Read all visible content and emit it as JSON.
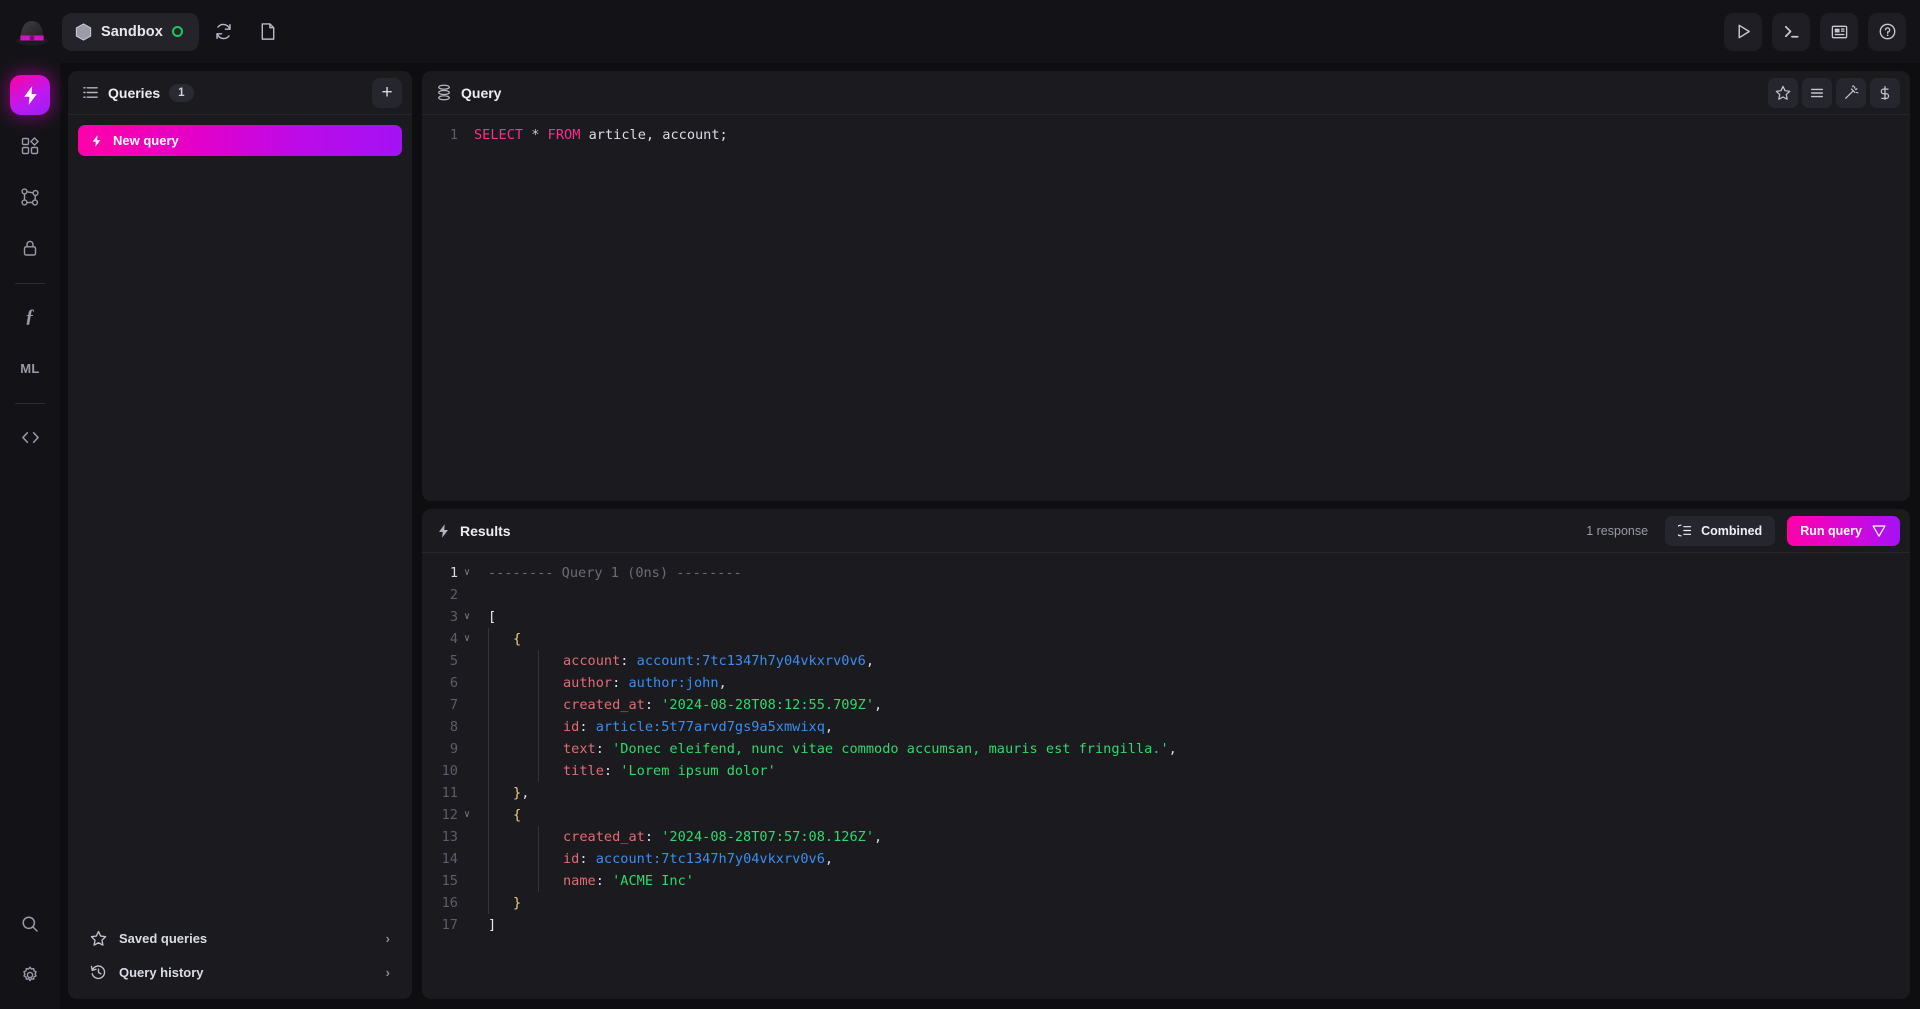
{
  "topbar": {
    "logo": "bowler-hat-logo",
    "namespace": "Sandbox",
    "status": "connected",
    "reconnect_icon": "refresh-icon",
    "file_icon": "file-icon",
    "actions": [
      {
        "icon": "play-icon",
        "name": "run"
      },
      {
        "icon": "terminal-icon",
        "name": "console"
      },
      {
        "icon": "docs-icon",
        "name": "documentation"
      },
      {
        "icon": "help-icon",
        "name": "help"
      }
    ]
  },
  "rail": {
    "items": [
      {
        "icon": "lightning-icon",
        "label": "",
        "active": true
      },
      {
        "icon": "grid-icon",
        "label": "",
        "active": false
      },
      {
        "icon": "graph-icon",
        "label": "",
        "active": false
      },
      {
        "icon": "lock-icon",
        "label": "",
        "active": false
      },
      {
        "icon": "function-icon",
        "label": "ƒ",
        "active": false
      },
      {
        "icon": "ml-icon",
        "label": "ML",
        "active": false
      },
      {
        "icon": "code-icon",
        "label": "",
        "active": false
      }
    ],
    "bottom": [
      {
        "icon": "search-icon",
        "name": "search"
      },
      {
        "icon": "gear-icon",
        "name": "settings"
      }
    ]
  },
  "queries": {
    "title": "Queries",
    "count": "1",
    "add_label": "+",
    "items": [
      {
        "label": "New query",
        "icon": "lightning-icon",
        "selected": true
      }
    ],
    "footer": [
      {
        "label": "Saved queries",
        "icon": "star-icon",
        "chevron": "›"
      },
      {
        "label": "Query history",
        "icon": "history-icon",
        "chevron": "›"
      }
    ]
  },
  "query_panel": {
    "title": "Query",
    "icon": "database-icon",
    "actions": [
      {
        "icon": "star-icon",
        "name": "save-query"
      },
      {
        "icon": "format-icon",
        "name": "format-query"
      },
      {
        "icon": "magic-wand-icon",
        "name": "beautify-query"
      },
      {
        "icon": "dollar-icon",
        "name": "variables"
      }
    ],
    "lines": [
      {
        "num": "1",
        "tokens": [
          {
            "t": "SELECT",
            "c": "kw"
          },
          {
            "t": " ",
            "c": "pl"
          },
          {
            "t": "*",
            "c": "op"
          },
          {
            "t": " ",
            "c": "pl"
          },
          {
            "t": "FROM",
            "c": "kw"
          },
          {
            "t": " article, account;",
            "c": "pl"
          }
        ]
      }
    ]
  },
  "results_panel": {
    "title": "Results",
    "icon": "lightning-icon",
    "response_count": "1 response",
    "combined_label": "Combined",
    "combined_icon": "list-icon",
    "run_label": "Run query",
    "run_icon": "send-icon",
    "lines": [
      {
        "num": "1",
        "fold": "v",
        "indent": 0,
        "current": true,
        "tokens": [
          {
            "t": "-------- Query 1 (0ns) --------",
            "c": "cmt"
          }
        ]
      },
      {
        "num": "2",
        "fold": "",
        "indent": 0,
        "tokens": []
      },
      {
        "num": "3",
        "fold": "v",
        "indent": 0,
        "tokens": [
          {
            "t": "[",
            "c": "brw"
          }
        ]
      },
      {
        "num": "4",
        "fold": "v",
        "indent": 1,
        "tokens": [
          {
            "t": "{",
            "c": "br"
          }
        ]
      },
      {
        "num": "5",
        "fold": "",
        "indent": 2,
        "tokens": [
          {
            "t": "account",
            "c": "key"
          },
          {
            "t": ": ",
            "c": "pl"
          },
          {
            "t": "account:7tc1347h7y04vkxrv0v6",
            "c": "rec"
          },
          {
            "t": ",",
            "c": "pl"
          }
        ]
      },
      {
        "num": "6",
        "fold": "",
        "indent": 2,
        "tokens": [
          {
            "t": "author",
            "c": "key"
          },
          {
            "t": ": ",
            "c": "pl"
          },
          {
            "t": "author:john",
            "c": "rec"
          },
          {
            "t": ",",
            "c": "pl"
          }
        ]
      },
      {
        "num": "7",
        "fold": "",
        "indent": 2,
        "tokens": [
          {
            "t": "created_at",
            "c": "key"
          },
          {
            "t": ": ",
            "c": "pl"
          },
          {
            "t": "'2024-08-28T08:12:55.709Z'",
            "c": "str"
          },
          {
            "t": ",",
            "c": "pl"
          }
        ]
      },
      {
        "num": "8",
        "fold": "",
        "indent": 2,
        "tokens": [
          {
            "t": "id",
            "c": "key"
          },
          {
            "t": ": ",
            "c": "pl"
          },
          {
            "t": "article:5t77arvd7gs9a5xmwixq",
            "c": "rec"
          },
          {
            "t": ",",
            "c": "pl"
          }
        ]
      },
      {
        "num": "9",
        "fold": "",
        "indent": 2,
        "tokens": [
          {
            "t": "text",
            "c": "key"
          },
          {
            "t": ": ",
            "c": "pl"
          },
          {
            "t": "'Donec eleifend, nunc vitae commodo accumsan, mauris est fringilla.'",
            "c": "str"
          },
          {
            "t": ",",
            "c": "pl"
          }
        ]
      },
      {
        "num": "10",
        "fold": "",
        "indent": 2,
        "tokens": [
          {
            "t": "title",
            "c": "key"
          },
          {
            "t": ": ",
            "c": "pl"
          },
          {
            "t": "'Lorem ipsum dolor'",
            "c": "str"
          }
        ]
      },
      {
        "num": "11",
        "fold": "",
        "indent": 1,
        "tokens": [
          {
            "t": "}",
            "c": "br"
          },
          {
            "t": ",",
            "c": "pl"
          }
        ]
      },
      {
        "num": "12",
        "fold": "v",
        "indent": 1,
        "tokens": [
          {
            "t": "{",
            "c": "br"
          }
        ]
      },
      {
        "num": "13",
        "fold": "",
        "indent": 2,
        "tokens": [
          {
            "t": "created_at",
            "c": "key"
          },
          {
            "t": ": ",
            "c": "pl"
          },
          {
            "t": "'2024-08-28T07:57:08.126Z'",
            "c": "str"
          },
          {
            "t": ",",
            "c": "pl"
          }
        ]
      },
      {
        "num": "14",
        "fold": "",
        "indent": 2,
        "tokens": [
          {
            "t": "id",
            "c": "key"
          },
          {
            "t": ": ",
            "c": "pl"
          },
          {
            "t": "account:7tc1347h7y04vkxrv0v6",
            "c": "rec"
          },
          {
            "t": ",",
            "c": "pl"
          }
        ]
      },
      {
        "num": "15",
        "fold": "",
        "indent": 2,
        "tokens": [
          {
            "t": "name",
            "c": "key"
          },
          {
            "t": ": ",
            "c": "pl"
          },
          {
            "t": "'ACME Inc'",
            "c": "str"
          }
        ]
      },
      {
        "num": "16",
        "fold": "",
        "indent": 1,
        "tokens": [
          {
            "t": "}",
            "c": "br"
          }
        ]
      },
      {
        "num": "17",
        "fold": "",
        "indent": 0,
        "tokens": [
          {
            "t": "]",
            "c": "brw"
          }
        ]
      }
    ]
  },
  "colors": {
    "accent_pink": "#ff00a8",
    "accent_purple": "#a312f5",
    "status_green": "#22c55e",
    "panel_bg": "#1a1a1f",
    "app_bg": "#0e0e11"
  }
}
